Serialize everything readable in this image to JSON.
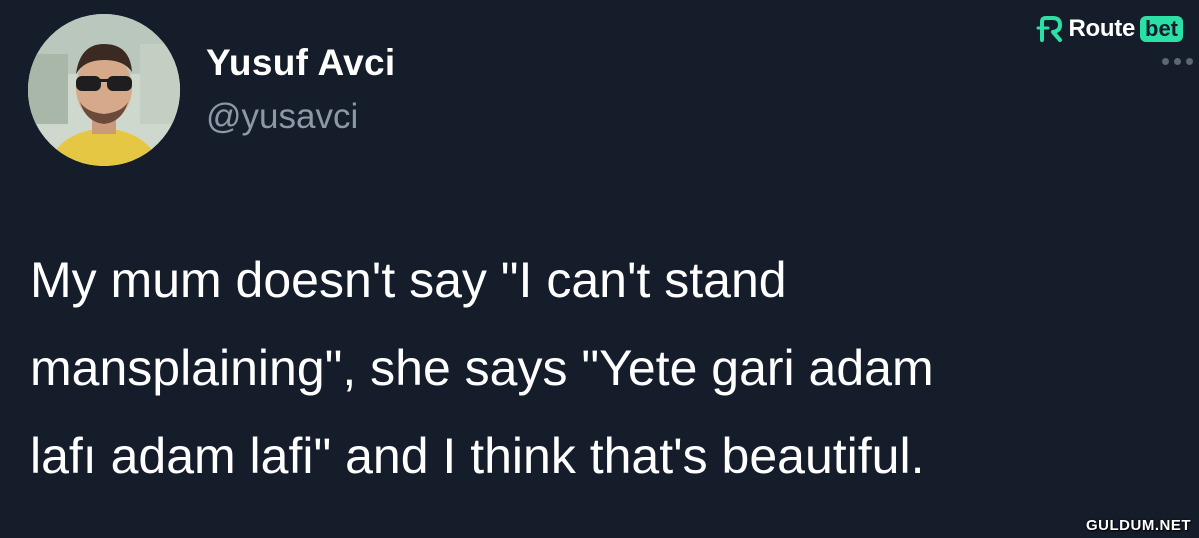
{
  "author": {
    "name": "Yusuf Avci",
    "handle": "@yusavci"
  },
  "tweet": {
    "lines": [
      "My mum doesn't say \"I can't stand",
      "mansplaining\", she says \"Yete gari adam",
      "lafı adam lafi\" and I think that's beautiful."
    ]
  },
  "brand": {
    "text": "Route",
    "badge": "bet",
    "accent": "#2be0a4"
  },
  "watermark": "GULDUM.NET",
  "colors": {
    "background": "#151d2b",
    "text": "#ffffff",
    "secondary": "#8b98a5"
  },
  "icons": {
    "more": "more-horizontal-icon",
    "brand": "routebet-logo-icon"
  }
}
